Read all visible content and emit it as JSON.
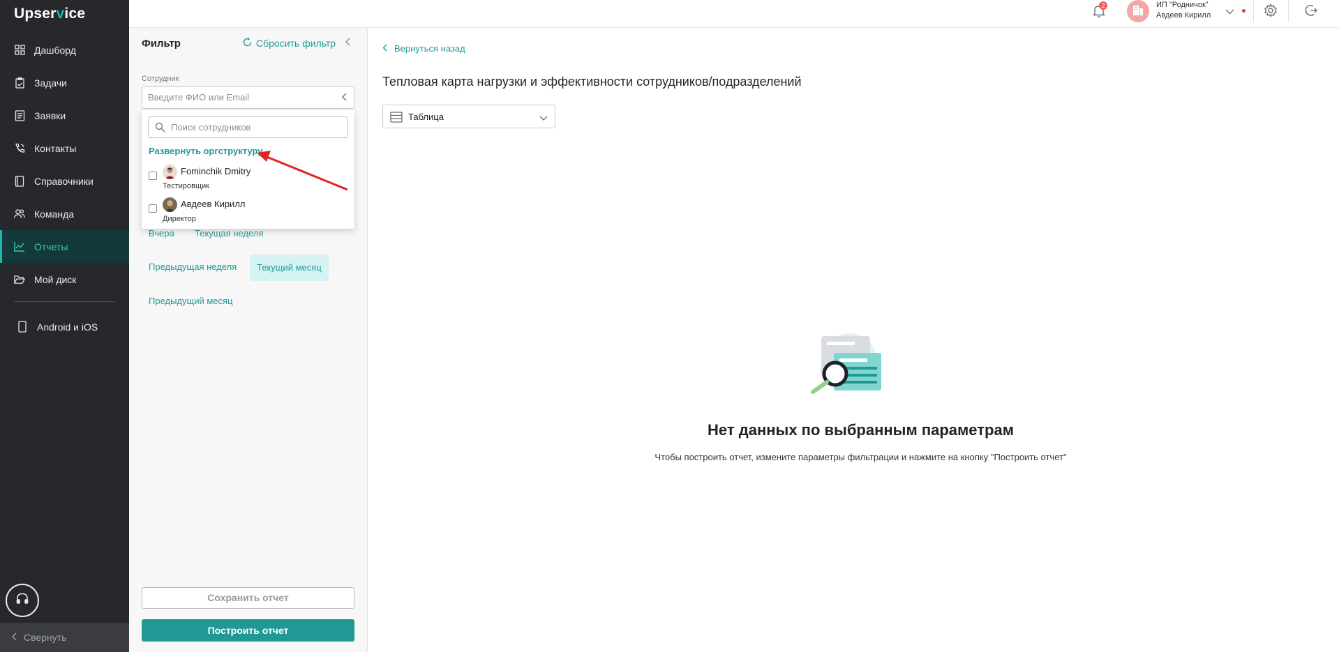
{
  "brand": {
    "logo_part1": "Upser",
    "logo_part2": "v",
    "logo_part3": "ice",
    "accent": "#22b7aa"
  },
  "sidebar": {
    "items": [
      {
        "label": "Дашборд",
        "icon": "grid-icon",
        "active": false
      },
      {
        "label": "Задачи",
        "icon": "clipboard-icon",
        "active": false
      },
      {
        "label": "Заявки",
        "icon": "tickets-icon",
        "active": false
      },
      {
        "label": "Контакты",
        "icon": "phone-icon",
        "active": false
      },
      {
        "label": "Справочники",
        "icon": "book-icon",
        "active": false
      },
      {
        "label": "Команда",
        "icon": "team-icon",
        "active": false
      },
      {
        "label": "Отчеты",
        "icon": "chart-icon",
        "active": true
      },
      {
        "label": "Мой диск",
        "icon": "folder-icon",
        "active": false
      }
    ],
    "mobile_label": "Android и iOS",
    "collapse_label": "Свернуть"
  },
  "topbar": {
    "notifications_count": "2",
    "org_line1": "ИП \"Родничок\"",
    "org_line2": "Авдеев Кирилл"
  },
  "filter": {
    "title": "Фильтр",
    "reset_label": "Сбросить фильтр",
    "employee_label": "Сотрудник",
    "employee_placeholder": "Введите ФИО или Email",
    "dropdown": {
      "search_placeholder": "Поиск сотрудников",
      "expand_label": "Развернуть оргструктуру",
      "employees": [
        {
          "name": "Fominchik Dmitry",
          "role": "Тестировщик"
        },
        {
          "name": "Авдеев Кирилл",
          "role": "Директор"
        }
      ]
    },
    "periods": {
      "yesterday": "Вчера",
      "current_week": "Текущая неделя",
      "previous_week": "Предыдущая неделя",
      "current_month": "Текущий месяц",
      "previous_month": "Предыдущий месяц"
    },
    "save_label": "Сохранить отчет",
    "build_label": "Построить отчет"
  },
  "main": {
    "back_label": "Вернуться назад",
    "title": "Тепловая карта нагрузки и эффективности сотрудников/подразделений",
    "view_select": "Таблица",
    "empty_title": "Нет данных по выбранным параметрам",
    "empty_subtitle": "Чтобы построить отчет, измените параметры фильтрации и нажмите на кнопку \"Построить отчет\""
  }
}
